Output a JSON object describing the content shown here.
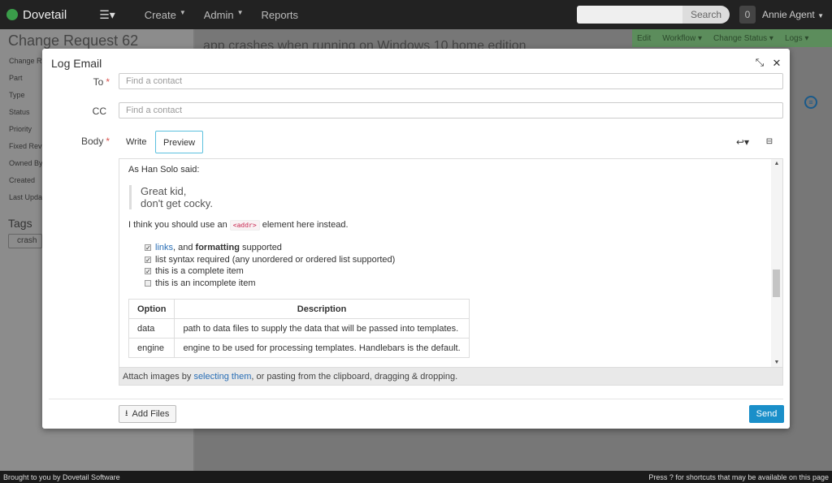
{
  "navbar": {
    "brand": "Dovetail",
    "links": [
      "Create",
      "Admin",
      "Reports"
    ],
    "search_label": "Search",
    "notification_count": "0",
    "user": "Annie Agent"
  },
  "background": {
    "title": "Change Request 62",
    "fields": [
      "Change R",
      "Part",
      "Type",
      "Status",
      "Priority",
      "Fixed Rev",
      "Owned By",
      "Created",
      "Last Upda"
    ],
    "tags_title": "Tags",
    "tag": "crash",
    "main_title": "app crashes when running on Windows 10 home edition",
    "toolbar": [
      "Edit",
      "Workflow ▾",
      "Change Status ▾",
      "Logs ▾"
    ]
  },
  "modal": {
    "title": "Log Email",
    "to_label": "To",
    "to_placeholder": "Find a contact",
    "cc_label": "CC",
    "cc_placeholder": "Find a contact",
    "body_label": "Body",
    "tabs": [
      "Write",
      "Preview"
    ],
    "preview": {
      "said": "As Han Solo said:",
      "quote_line1": "Great kid,",
      "quote_line2": "don't get cocky.",
      "suggest_pre": "I think you should use an",
      "suggest_code": "<addr>",
      "suggest_post": "element here instead.",
      "task1_link": "links",
      "task1_mid": ", and",
      "task1_bold": "formatting",
      "task1_end": "supported",
      "task2": "list syntax required (any unordered or ordered list supported)",
      "task3": "this is a complete item",
      "task4": "this is an incomplete item",
      "table_headers": [
        "Option",
        "Description"
      ],
      "table_rows": [
        [
          "data",
          "path to data files to supply the data that will be passed into templates."
        ],
        [
          "engine",
          "engine to be used for processing templates. Handlebars is the default."
        ]
      ]
    },
    "attach_pre": "Attach images by",
    "attach_link": "selecting them",
    "attach_post": ", or pasting from the clipboard, dragging & dropping.",
    "add_files": "Add Files",
    "send": "Send"
  },
  "footer": {
    "left": "Brought to you by Dovetail Software",
    "right": "Press ? for shortcuts that may be available on this page"
  }
}
